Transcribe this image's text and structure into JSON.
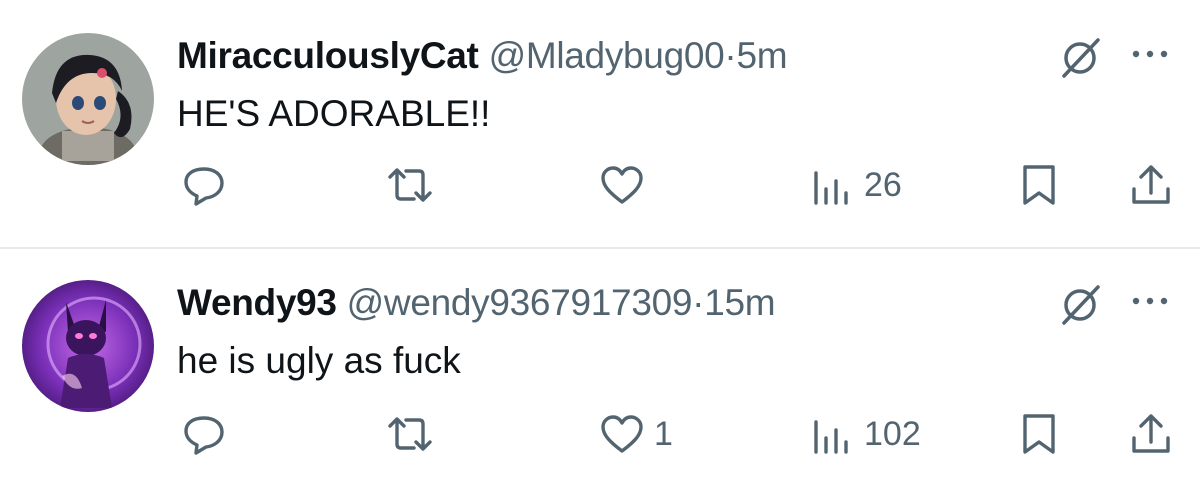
{
  "tweets": [
    {
      "display_name": "MiracculouslyCat",
      "handle": "@Mladybug00",
      "separator": "·",
      "time": "5m",
      "text": "HE'S ADORABLE!!",
      "likes": "",
      "views": "26",
      "avatar_icon": "animated-girl-avatar"
    },
    {
      "display_name": "Wendy93",
      "handle": "@wendy9367917309",
      "separator": "·",
      "time": "15m",
      "text": "he is ugly as fuck",
      "likes": "1",
      "views": "102",
      "avatar_icon": "purple-character-avatar"
    }
  ],
  "icons": {
    "reply": "reply-icon",
    "repost": "repost-icon",
    "like": "like-icon",
    "views": "views-icon",
    "bookmark": "bookmark-icon",
    "share": "share-icon",
    "grok": "grok-icon",
    "more": "more-icon"
  },
  "colors": {
    "text_primary": "#0f1419",
    "text_secondary": "#536471",
    "divider": "#e7e9ea"
  }
}
